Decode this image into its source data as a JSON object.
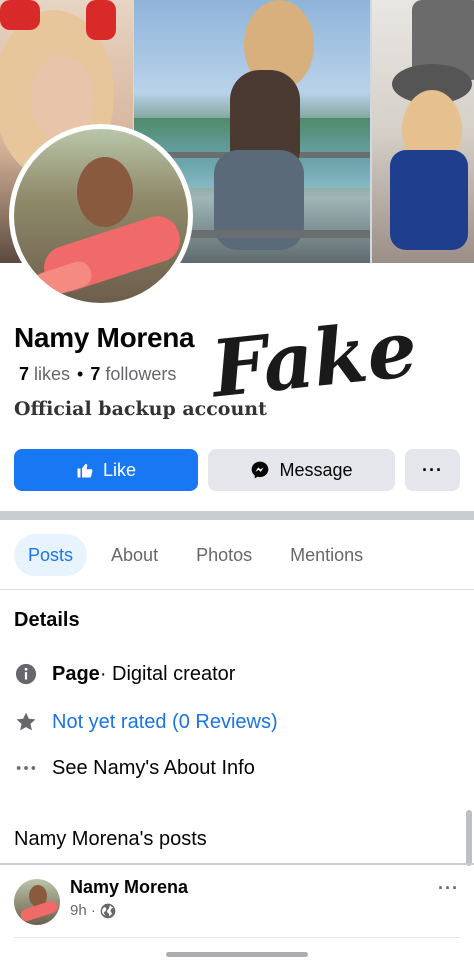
{
  "profile": {
    "name": "Namy Morena",
    "likes_count": "7",
    "likes_label": "likes",
    "followers_count": "7",
    "followers_label": "followers",
    "bio": "Official backup account",
    "stamp_text": "Fake"
  },
  "actions": {
    "like_label": "Like",
    "message_label": "Message",
    "more_label": "···"
  },
  "tabs": [
    {
      "label": "Posts",
      "active": true
    },
    {
      "label": "About",
      "active": false
    },
    {
      "label": "Photos",
      "active": false
    },
    {
      "label": "Mentions",
      "active": false
    }
  ],
  "details": {
    "title": "Details",
    "page_label": "Page",
    "page_category": " · Digital creator",
    "rating_text": "Not yet rated (0 Reviews)",
    "about_text": "See Namy's About Info"
  },
  "posts_section": {
    "title": "Namy Morena's posts"
  },
  "post": {
    "author": "Namy Morena",
    "time": "9h ·",
    "more_label": "···"
  },
  "icons": {
    "like": "thumbs-up-icon",
    "message": "messenger-icon",
    "info": "info-icon",
    "star": "star-icon",
    "more": "ellipsis-icon",
    "globe": "globe-icon"
  },
  "colors": {
    "primary": "#1877f2",
    "link": "#1b74e4",
    "secondary_text": "#65676b",
    "button_gray": "#e4e6eb",
    "active_tab_bg": "#e7f3ff"
  }
}
